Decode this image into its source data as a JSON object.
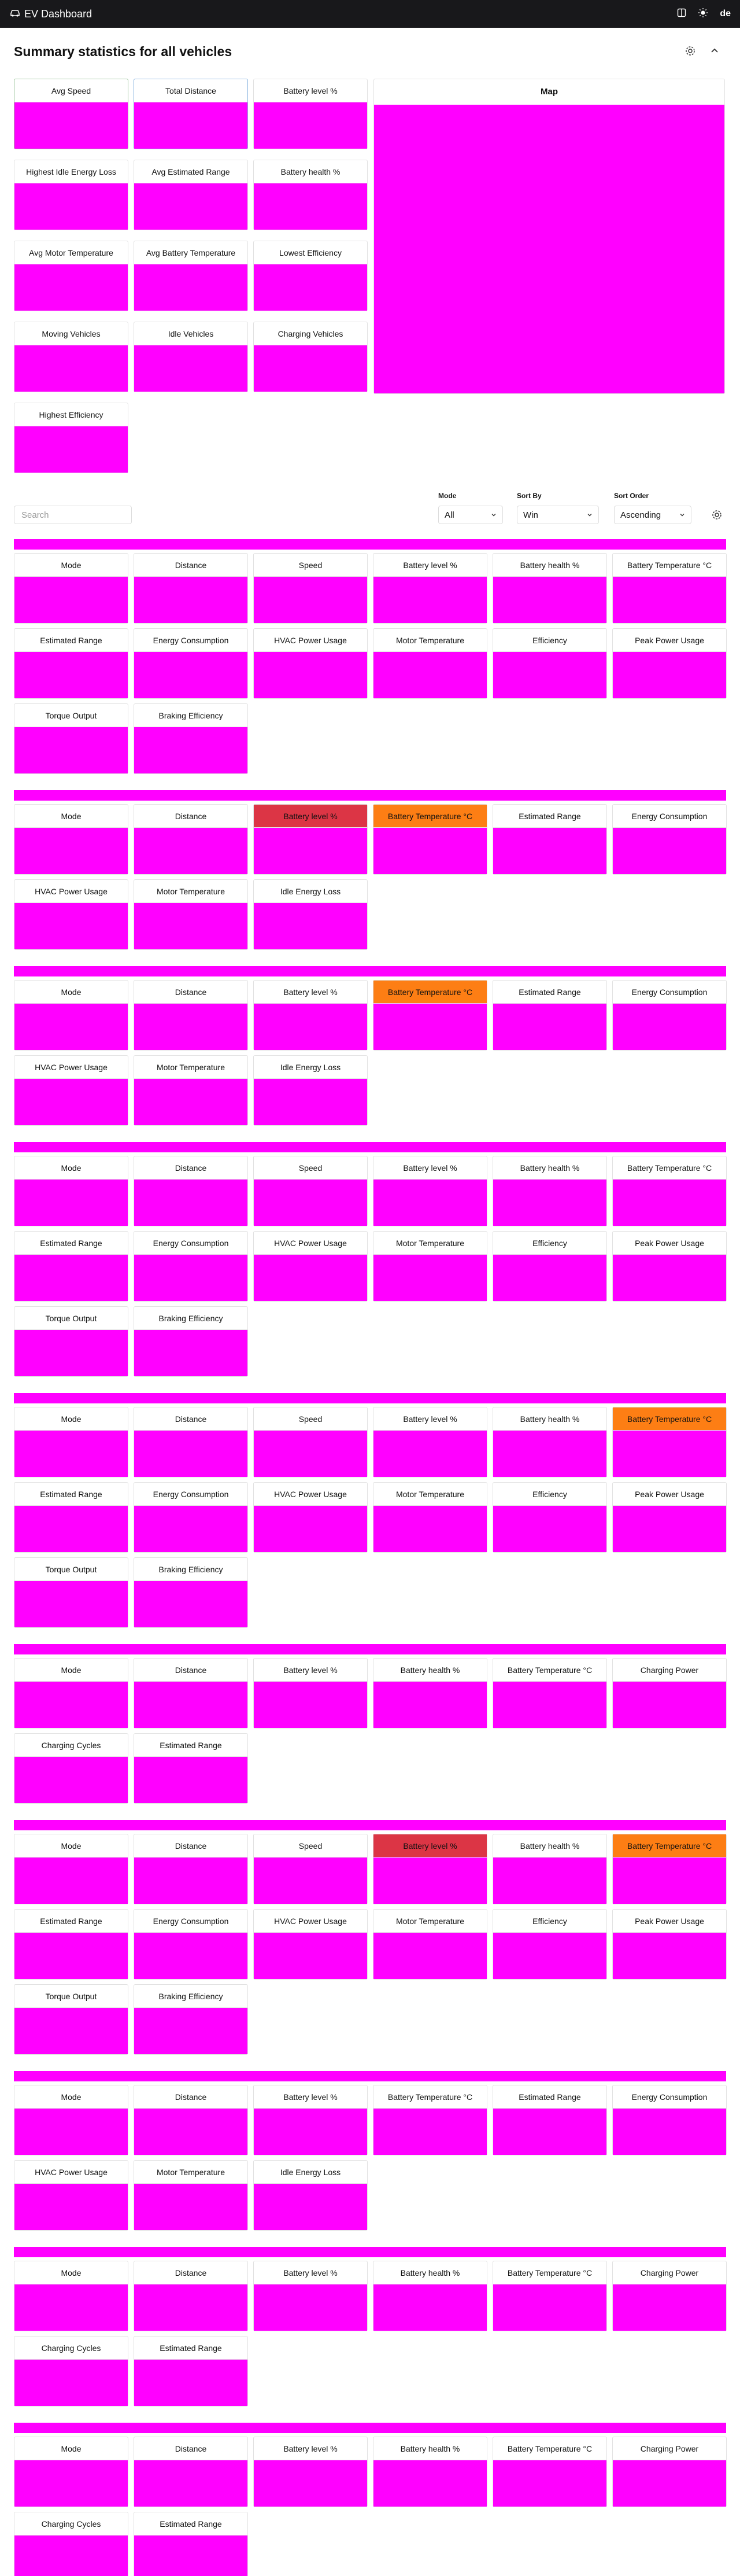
{
  "header": {
    "title": "EV Dashboard",
    "lang": "de"
  },
  "summary": {
    "title": "Summary statistics for all vehicles",
    "cards": [
      {
        "label": "Avg Speed",
        "hl": "green"
      },
      {
        "label": "Total Distance",
        "hl": "blue"
      },
      {
        "label": "Battery level %"
      },
      {
        "label": "Highest Idle Energy Loss"
      },
      {
        "label": "Avg Estimated Range"
      },
      {
        "label": "Battery health %"
      },
      {
        "label": "Avg Motor Temperature"
      },
      {
        "label": "Avg Battery Temperature"
      },
      {
        "label": "Lowest Efficiency"
      },
      {
        "label": "Moving Vehicles"
      },
      {
        "label": "Idle Vehicles"
      },
      {
        "label": "Charging Vehicles"
      },
      {
        "label": "Highest Efficiency"
      }
    ],
    "map_label": "Map"
  },
  "controls": {
    "search_placeholder": "Search",
    "mode": {
      "label": "Mode",
      "value": "All"
    },
    "sort_by": {
      "label": "Sort By",
      "value": "Win"
    },
    "sort_order": {
      "label": "Sort Order",
      "value": "Ascending"
    }
  },
  "colors": {
    "placeholder": "#ff00ff",
    "alert_red": "#dc3545",
    "alert_orange": "#fd7e14"
  },
  "vehicles": [
    {
      "cards": [
        {
          "label": "Mode"
        },
        {
          "label": "Distance"
        },
        {
          "label": "Speed"
        },
        {
          "label": "Battery level %"
        },
        {
          "label": "Battery health %"
        },
        {
          "label": "Battery Temperature °C"
        },
        {
          "label": "Estimated Range"
        },
        {
          "label": "Energy Consumption"
        },
        {
          "label": "HVAC Power Usage"
        },
        {
          "label": "Motor Temperature"
        },
        {
          "label": "Efficiency"
        },
        {
          "label": "Peak Power Usage"
        },
        {
          "label": "Torque Output"
        },
        {
          "label": "Braking Efficiency"
        }
      ]
    },
    {
      "cards": [
        {
          "label": "Mode"
        },
        {
          "label": "Distance"
        },
        {
          "label": "Battery level %",
          "state": "red"
        },
        {
          "label": "Battery Temperature °C",
          "state": "orange"
        },
        {
          "label": "Estimated Range"
        },
        {
          "label": "Energy Consumption"
        },
        {
          "label": "HVAC Power Usage"
        },
        {
          "label": "Motor Temperature"
        },
        {
          "label": "Idle Energy Loss"
        }
      ]
    },
    {
      "cards": [
        {
          "label": "Mode"
        },
        {
          "label": "Distance"
        },
        {
          "label": "Battery level %"
        },
        {
          "label": "Battery Temperature °C",
          "state": "orange"
        },
        {
          "label": "Estimated Range"
        },
        {
          "label": "Energy Consumption"
        },
        {
          "label": "HVAC Power Usage"
        },
        {
          "label": "Motor Temperature"
        },
        {
          "label": "Idle Energy Loss"
        }
      ]
    },
    {
      "cards": [
        {
          "label": "Mode"
        },
        {
          "label": "Distance"
        },
        {
          "label": "Speed"
        },
        {
          "label": "Battery level %"
        },
        {
          "label": "Battery health %"
        },
        {
          "label": "Battery Temperature °C"
        },
        {
          "label": "Estimated Range"
        },
        {
          "label": "Energy Consumption"
        },
        {
          "label": "HVAC Power Usage"
        },
        {
          "label": "Motor Temperature"
        },
        {
          "label": "Efficiency"
        },
        {
          "label": "Peak Power Usage"
        },
        {
          "label": "Torque Output"
        },
        {
          "label": "Braking Efficiency"
        }
      ]
    },
    {
      "cards": [
        {
          "label": "Mode"
        },
        {
          "label": "Distance"
        },
        {
          "label": "Speed"
        },
        {
          "label": "Battery level %"
        },
        {
          "label": "Battery health %"
        },
        {
          "label": "Battery Temperature °C",
          "state": "orange"
        },
        {
          "label": "Estimated Range"
        },
        {
          "label": "Energy Consumption"
        },
        {
          "label": "HVAC Power Usage"
        },
        {
          "label": "Motor Temperature"
        },
        {
          "label": "Efficiency"
        },
        {
          "label": "Peak Power Usage"
        },
        {
          "label": "Torque Output"
        },
        {
          "label": "Braking Efficiency"
        }
      ]
    },
    {
      "cards": [
        {
          "label": "Mode"
        },
        {
          "label": "Distance"
        },
        {
          "label": "Battery level %"
        },
        {
          "label": "Battery health %"
        },
        {
          "label": "Battery Temperature °C"
        },
        {
          "label": "Charging Power"
        },
        {
          "label": "Charging Cycles"
        },
        {
          "label": "Estimated Range"
        }
      ]
    },
    {
      "cards": [
        {
          "label": "Mode"
        },
        {
          "label": "Distance"
        },
        {
          "label": "Speed"
        },
        {
          "label": "Battery level %",
          "state": "red"
        },
        {
          "label": "Battery health %"
        },
        {
          "label": "Battery Temperature °C",
          "state": "orange"
        },
        {
          "label": "Estimated Range"
        },
        {
          "label": "Energy Consumption"
        },
        {
          "label": "HVAC Power Usage"
        },
        {
          "label": "Motor Temperature"
        },
        {
          "label": "Efficiency"
        },
        {
          "label": "Peak Power Usage"
        },
        {
          "label": "Torque Output"
        },
        {
          "label": "Braking Efficiency"
        }
      ]
    },
    {
      "cards": [
        {
          "label": "Mode"
        },
        {
          "label": "Distance"
        },
        {
          "label": "Battery level %"
        },
        {
          "label": "Battery Temperature °C"
        },
        {
          "label": "Estimated Range"
        },
        {
          "label": "Energy Consumption"
        },
        {
          "label": "HVAC Power Usage"
        },
        {
          "label": "Motor Temperature"
        },
        {
          "label": "Idle Energy Loss"
        }
      ]
    },
    {
      "cards": [
        {
          "label": "Mode"
        },
        {
          "label": "Distance"
        },
        {
          "label": "Battery level %"
        },
        {
          "label": "Battery health %"
        },
        {
          "label": "Battery Temperature °C"
        },
        {
          "label": "Charging Power"
        },
        {
          "label": "Charging Cycles"
        },
        {
          "label": "Estimated Range"
        }
      ]
    },
    {
      "cards": [
        {
          "label": "Mode"
        },
        {
          "label": "Distance"
        },
        {
          "label": "Battery level %"
        },
        {
          "label": "Battery health %"
        },
        {
          "label": "Battery Temperature °C"
        },
        {
          "label": "Charging Power"
        },
        {
          "label": "Charging Cycles"
        },
        {
          "label": "Estimated Range"
        }
      ]
    }
  ]
}
